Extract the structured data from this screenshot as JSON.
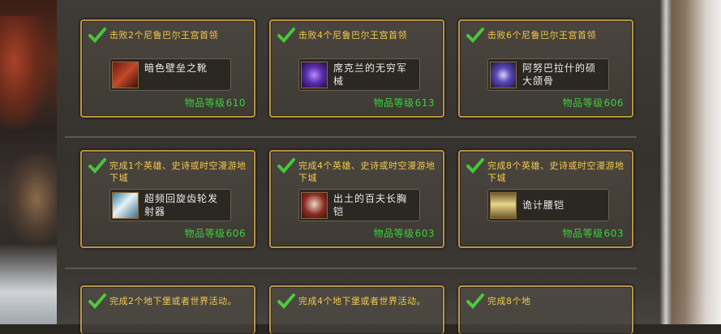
{
  "level_label": "物品等级",
  "cards": [
    {
      "title": "击败2个尼鲁巴尔王宫首领",
      "item": "暗色壁垒之靴",
      "level": "610",
      "icon": "boots-icon"
    },
    {
      "title": "击败4个尼鲁巴尔王宫首领",
      "item": "席克兰的无穷军械",
      "level": "613",
      "icon": "void-weapon-icon"
    },
    {
      "title": "击败6个尼鲁巴尔王宫首领",
      "item": "阿努巴拉什的硕大颌骨",
      "level": "606",
      "icon": "spider-mandible-icon"
    },
    {
      "title": "完成1个英雄、史诗或时空漫游地下城",
      "item": "超频回旋齿轮发射器",
      "level": "606",
      "icon": "gear-launcher-icon"
    },
    {
      "title": "完成4个英雄、史诗或时空漫游地下城",
      "item": "出土的百夫长胸铠",
      "level": "603",
      "icon": "chestplate-icon"
    },
    {
      "title": "完成8个英雄、史诗或时空漫游地下城",
      "item": "诡计腰铠",
      "level": "603",
      "icon": "belt-icon"
    },
    {
      "title": "完成2个地下堡或者世界活动。",
      "item": "",
      "level": "",
      "icon": ""
    },
    {
      "title": "完成4个地下堡或者世界活动。",
      "item": "",
      "level": "",
      "icon": ""
    },
    {
      "title": "完成8个地",
      "item": "",
      "level": "",
      "icon": ""
    }
  ],
  "colors": {
    "accent_gold": "#b89446",
    "title_yellow": "#f2c94c",
    "level_green": "#3cd03c",
    "check_green": "#46c83a"
  }
}
